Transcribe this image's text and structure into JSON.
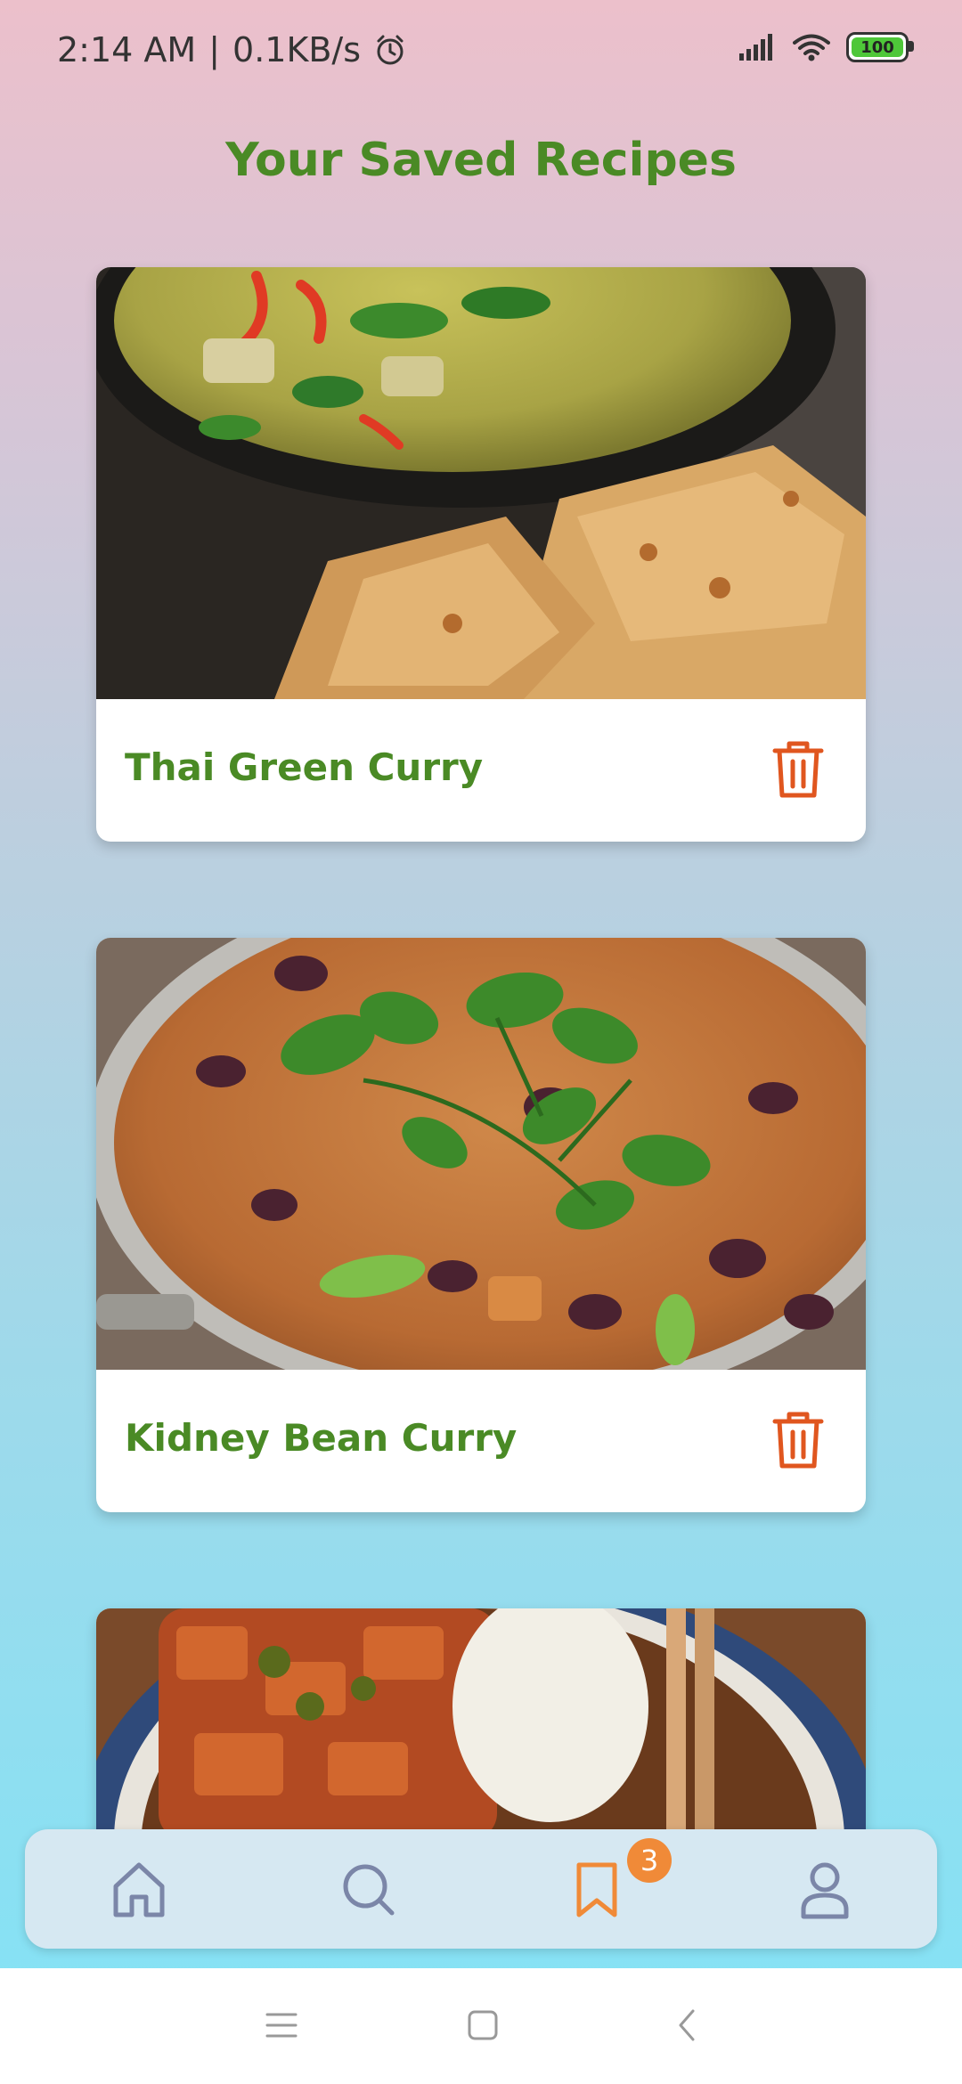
{
  "status": {
    "time": "2:14 AM",
    "speed": "0.1KB/s",
    "battery": "100"
  },
  "page": {
    "title": "Your Saved Recipes"
  },
  "recipes": [
    {
      "title": "Thai Green Curry"
    },
    {
      "title": "Kidney Bean Curry"
    },
    {
      "title": ""
    }
  ],
  "nav": {
    "saved_count": "3",
    "active": "saved"
  },
  "colors": {
    "accent_green": "#4a8a25",
    "accent_orange": "#f08a38",
    "delete_red": "#e0561f"
  },
  "icons": [
    "alarm-icon",
    "signal-icon",
    "wifi-icon",
    "battery-icon",
    "trash-icon",
    "home-icon",
    "search-icon",
    "bookmark-icon",
    "user-icon",
    "menu-icon",
    "square-icon",
    "back-icon"
  ]
}
